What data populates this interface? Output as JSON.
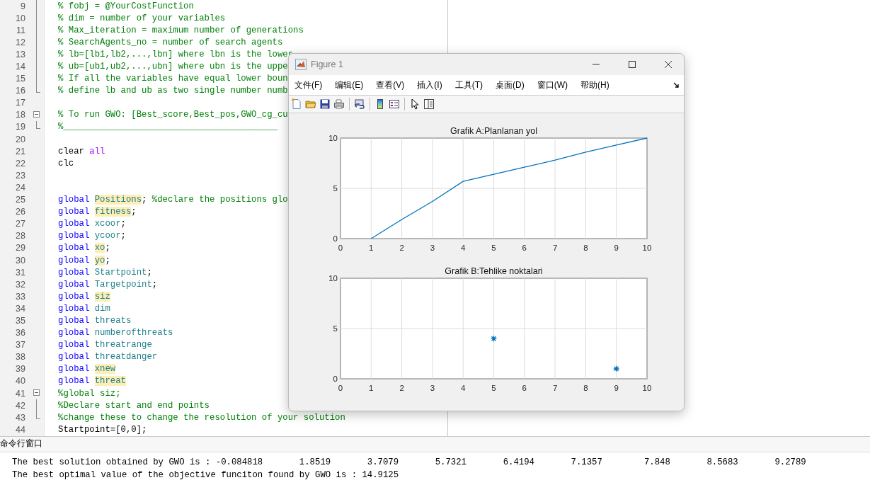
{
  "editor": {
    "lines": [
      {
        "num": "9",
        "fold_line": true,
        "tokens": [
          {
            "kind": "comment",
            "text": "% fobj = @YourCostFunction"
          }
        ]
      },
      {
        "num": "10",
        "fold_line": true,
        "tokens": [
          {
            "kind": "comment",
            "text": "% dim = number of your variables"
          }
        ]
      },
      {
        "num": "11",
        "fold_line": true,
        "tokens": [
          {
            "kind": "comment",
            "text": "% Max_iteration = maximum number of generations"
          }
        ]
      },
      {
        "num": "12",
        "fold_line": true,
        "tokens": [
          {
            "kind": "comment",
            "text": "% SearchAgents_no = number of search agents"
          }
        ]
      },
      {
        "num": "13",
        "fold_line": true,
        "tokens": [
          {
            "kind": "comment",
            "text": "% lb=[lb1,lb2,...,lbn] where lbn is the lower"
          }
        ]
      },
      {
        "num": "14",
        "fold_line": true,
        "tokens": [
          {
            "kind": "comment",
            "text": "% ub=[ub1,ub2,...,ubn] where ubn is the uppe"
          }
        ]
      },
      {
        "num": "15",
        "fold_line": true,
        "tokens": [
          {
            "kind": "comment",
            "text": "% If all the variables have equal lower boun"
          }
        ]
      },
      {
        "num": "16",
        "fold_end": true,
        "tokens": [
          {
            "kind": "comment",
            "text": "% define lb and ub as two single number numb"
          }
        ]
      },
      {
        "num": "17"
      },
      {
        "num": "18",
        "fold_start": true,
        "tokens": [
          {
            "kind": "comment",
            "text": "% To run GWO: [Best_score,Best_pos,GWO_cg_cu"
          }
        ]
      },
      {
        "num": "19",
        "fold_end": true,
        "tokens": [
          {
            "kind": "comment",
            "text": "%_________________________________________"
          }
        ]
      },
      {
        "num": "20"
      },
      {
        "num": "21",
        "tokens": [
          {
            "kind": "plain",
            "text": "clear "
          },
          {
            "kind": "string",
            "text": "all"
          }
        ]
      },
      {
        "num": "22",
        "tokens": [
          {
            "kind": "plain",
            "text": "clc"
          }
        ]
      },
      {
        "num": "23"
      },
      {
        "num": "24"
      },
      {
        "num": "25",
        "tokens": [
          {
            "kind": "keyword",
            "text": "global "
          },
          {
            "kind": "highlight",
            "text": "Positions"
          },
          {
            "kind": "plain",
            "text": ";"
          },
          {
            "kind": "comment",
            "text": " %declare the positions glo"
          }
        ]
      },
      {
        "num": "26",
        "tokens": [
          {
            "kind": "keyword",
            "text": "global "
          },
          {
            "kind": "highlight",
            "text": "fitness"
          },
          {
            "kind": "plain",
            "text": ";"
          }
        ]
      },
      {
        "num": "27",
        "tokens": [
          {
            "kind": "keyword",
            "text": "global "
          },
          {
            "kind": "variable",
            "text": "xcoor"
          },
          {
            "kind": "plain",
            "text": ";"
          }
        ]
      },
      {
        "num": "28",
        "tokens": [
          {
            "kind": "keyword",
            "text": "global "
          },
          {
            "kind": "variable",
            "text": "ycoor"
          },
          {
            "kind": "plain",
            "text": ";"
          }
        ]
      },
      {
        "num": "29",
        "tokens": [
          {
            "kind": "keyword",
            "text": "global "
          },
          {
            "kind": "highlight",
            "text": "xo"
          },
          {
            "kind": "plain",
            "text": ";"
          }
        ]
      },
      {
        "num": "30",
        "tokens": [
          {
            "kind": "keyword",
            "text": "global "
          },
          {
            "kind": "highlight",
            "text": "yo"
          },
          {
            "kind": "plain",
            "text": ";"
          }
        ]
      },
      {
        "num": "31",
        "tokens": [
          {
            "kind": "keyword",
            "text": "global "
          },
          {
            "kind": "variable",
            "text": "Startpoint"
          },
          {
            "kind": "plain",
            "text": ";"
          }
        ]
      },
      {
        "num": "32",
        "tokens": [
          {
            "kind": "keyword",
            "text": "global "
          },
          {
            "kind": "variable",
            "text": "Targetpoint"
          },
          {
            "kind": "plain",
            "text": ";"
          }
        ]
      },
      {
        "num": "33",
        "tokens": [
          {
            "kind": "keyword",
            "text": "global "
          },
          {
            "kind": "highlight",
            "text": "siz"
          }
        ]
      },
      {
        "num": "34",
        "tokens": [
          {
            "kind": "keyword",
            "text": "global "
          },
          {
            "kind": "variable",
            "text": "dim"
          }
        ]
      },
      {
        "num": "35",
        "tokens": [
          {
            "kind": "keyword",
            "text": "global "
          },
          {
            "kind": "variable",
            "text": "threats"
          }
        ]
      },
      {
        "num": "36",
        "tokens": [
          {
            "kind": "keyword",
            "text": "global "
          },
          {
            "kind": "variable",
            "text": "numberofthreats"
          }
        ]
      },
      {
        "num": "37",
        "tokens": [
          {
            "kind": "keyword",
            "text": "global "
          },
          {
            "kind": "variable",
            "text": "threatrange"
          }
        ]
      },
      {
        "num": "38",
        "tokens": [
          {
            "kind": "keyword",
            "text": "global "
          },
          {
            "kind": "variable",
            "text": "threatdanger"
          }
        ]
      },
      {
        "num": "39",
        "tokens": [
          {
            "kind": "keyword",
            "text": "global "
          },
          {
            "kind": "highlight",
            "text": "xnew"
          }
        ]
      },
      {
        "num": "40",
        "tokens": [
          {
            "kind": "keyword",
            "text": "global "
          },
          {
            "kind": "highlight",
            "text": "threat"
          }
        ]
      },
      {
        "num": "41",
        "fold_start": true,
        "tokens": [
          {
            "kind": "comment",
            "text": "%global siz;"
          }
        ]
      },
      {
        "num": "42",
        "fold_line": true,
        "tokens": [
          {
            "kind": "comment",
            "text": "%Declare start and end points"
          }
        ]
      },
      {
        "num": "43",
        "fold_end": true,
        "tokens": [
          {
            "kind": "comment",
            "text": "%change these to change the resolution of your solution"
          }
        ]
      },
      {
        "num": "44",
        "tokens": [
          {
            "kind": "plain",
            "text": "Startpoint=[0,0];"
          }
        ]
      }
    ]
  },
  "figure": {
    "title": "Figure 1",
    "menu": [
      "文件(F)",
      "编辑(E)",
      "查看(V)",
      "插入(I)",
      "工具(T)",
      "桌面(D)",
      "窗口(W)",
      "帮助(H)"
    ],
    "charts": [
      {
        "chart_data": {
          "type": "line",
          "title": "Grafik A:Planlanan yol",
          "x": [
            1,
            2,
            3,
            4,
            5,
            6,
            7,
            8,
            9,
            10
          ],
          "series": [
            {
              "color": "#0072bd",
              "values": [
                0,
                1.9,
                3.7,
                5.7,
                6.4,
                7.1,
                7.8,
                8.6,
                9.3,
                10
              ]
            }
          ],
          "xlim": [
            0,
            10
          ],
          "ylim": [
            0,
            10
          ],
          "xticks": [
            0,
            1,
            2,
            3,
            4,
            5,
            6,
            7,
            8,
            9,
            10
          ],
          "yticks": [
            0,
            5,
            10
          ],
          "grid": true
        }
      },
      {
        "chart_data": {
          "type": "scatter",
          "title": "Grafik B:Tehlike noktalari",
          "x": [
            5,
            9
          ],
          "series": [
            {
              "color": "#0072bd",
              "values": [
                4,
                1
              ]
            }
          ],
          "xlim": [
            0,
            10
          ],
          "ylim": [
            0,
            10
          ],
          "xticks": [
            0,
            1,
            2,
            3,
            4,
            5,
            6,
            7,
            8,
            9,
            10
          ],
          "yticks": [
            0,
            5,
            10
          ],
          "grid": true
        }
      }
    ]
  },
  "command_window": {
    "title": "命令行窗口",
    "lines": [
      "The best solution obtained by GWO is : -0.084818       1.8519       3.7079       5.7321       6.4194       7.1357        7.848       8.5683       9.2789",
      "The best optimal value of the objective funciton found by GWO is : 14.9125"
    ]
  }
}
